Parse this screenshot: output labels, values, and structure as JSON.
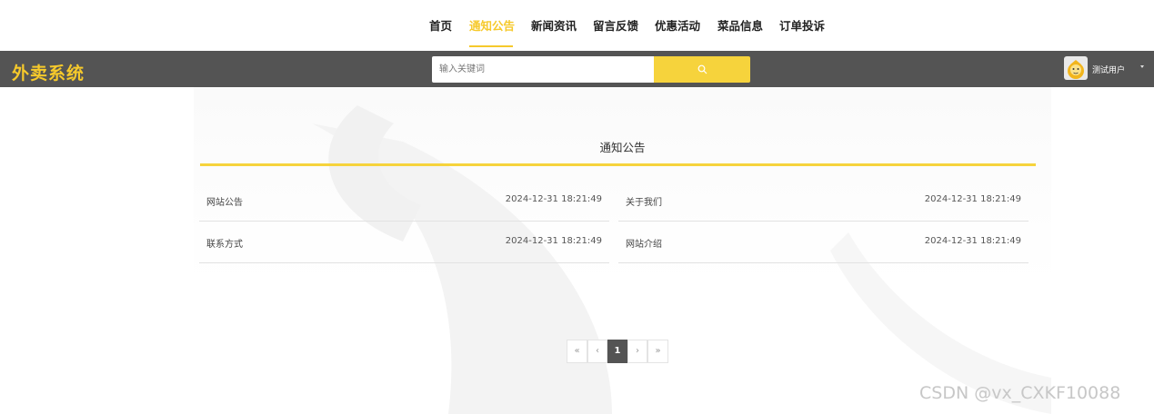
{
  "nav": {
    "items": [
      {
        "label": "首页",
        "active": false
      },
      {
        "label": "通知公告",
        "active": true
      },
      {
        "label": "新闻资讯",
        "active": false
      },
      {
        "label": "留言反馈",
        "active": false
      },
      {
        "label": "优惠活动",
        "active": false
      },
      {
        "label": "菜品信息",
        "active": false
      },
      {
        "label": "订单投诉",
        "active": false
      }
    ]
  },
  "header": {
    "logo": "外卖系统",
    "search": {
      "placeholder": "输入关键词",
      "value": "",
      "icon": "search-icon"
    },
    "user": {
      "name": "测试用户",
      "avatar": "avatar-cartoon-icon"
    }
  },
  "main": {
    "title": "通知公告",
    "notices": [
      {
        "title": "网站公告",
        "date": "2024-12-31 18:21:49"
      },
      {
        "title": "关于我们",
        "date": "2024-12-31 18:21:49"
      },
      {
        "title": "联系方式",
        "date": "2024-12-31 18:21:49"
      },
      {
        "title": "网站介绍",
        "date": "2024-12-31 18:21:49"
      }
    ],
    "pagination": {
      "first": "«",
      "prev": "‹",
      "current": "1",
      "next": "›",
      "last": "»"
    }
  },
  "watermark": "CSDN @vx_CXKF10088",
  "colors": {
    "accent": "#f6d33c",
    "header_bg": "#545454",
    "active_nav": "#f6c92b"
  }
}
